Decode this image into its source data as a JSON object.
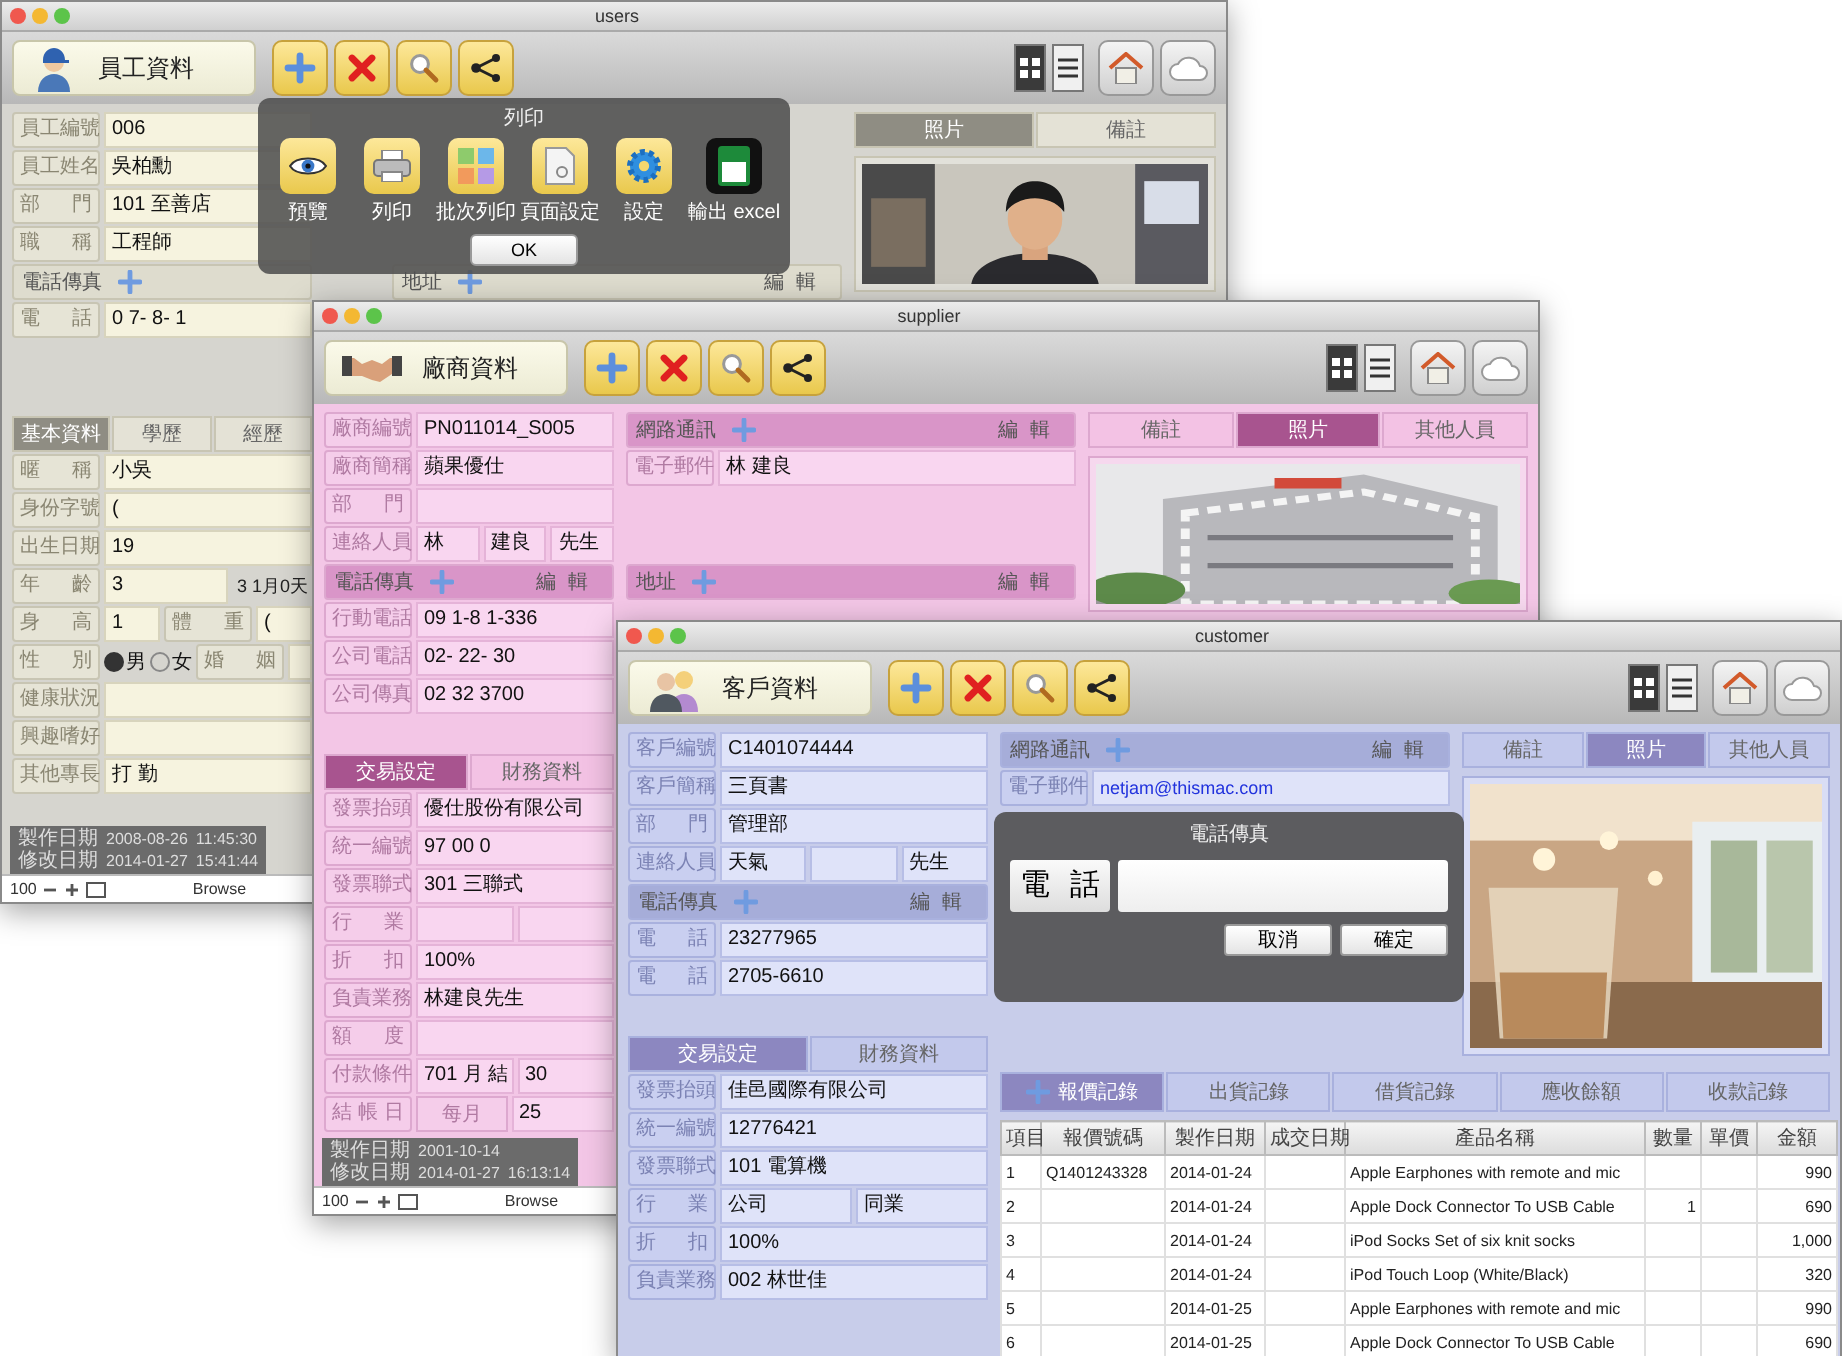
{
  "windows": [
    {
      "kind": "employee",
      "title": "users",
      "heading": "員工資料",
      "popover": {
        "title": "列印",
        "items": [
          {
            "label": "預覽"
          },
          {
            "label": "列印"
          },
          {
            "label": "批次列印"
          },
          {
            "label": "頁面設定"
          },
          {
            "label": "設定"
          },
          {
            "label": "輸出 excel"
          }
        ],
        "ok": "OK"
      },
      "left": [
        {
          "kind": "field",
          "cells": [
            {
              "kind": "label",
              "text": "員工編號"
            },
            {
              "kind": "value",
              "text": "006"
            }
          ]
        },
        {
          "kind": "field",
          "cells": [
            {
              "kind": "label",
              "text": "員工姓名"
            },
            {
              "kind": "value",
              "text": "吳柏勳"
            }
          ]
        },
        {
          "kind": "field",
          "cells": [
            {
              "kind": "label",
              "text": "部門"
            },
            {
              "kind": "value",
              "text": "101 至善店"
            }
          ]
        },
        {
          "kind": "field",
          "cells": [
            {
              "kind": "label",
              "text": "職稱"
            },
            {
              "kind": "value",
              "text": "工程師"
            }
          ]
        },
        {
          "kind": "section",
          "label": "電話傳真"
        },
        {
          "kind": "field",
          "cells": [
            {
              "kind": "label",
              "text": "電話"
            },
            {
              "kind": "value",
              "text": "0 7- 8- 1"
            }
          ]
        },
        {
          "kind": "gap"
        },
        {
          "kind": "gap"
        },
        {
          "kind": "tabs",
          "tabs": [
            {
              "label": "基本資料",
              "selected": true
            },
            {
              "label": "學歷",
              "selected": false
            },
            {
              "label": "經歷",
              "selected": false
            }
          ]
        },
        {
          "kind": "field",
          "cells": [
            {
              "kind": "label",
              "text": "暱稱"
            },
            {
              "kind": "value",
              "text": "小吳"
            }
          ]
        },
        {
          "kind": "field",
          "cells": [
            {
              "kind": "label",
              "text": "身份字號"
            },
            {
              "kind": "value",
              "text": "("
            }
          ]
        },
        {
          "kind": "field",
          "cells": [
            {
              "kind": "label",
              "text": "出生日期"
            },
            {
              "kind": "value",
              "text": "19"
            }
          ]
        },
        {
          "kind": "field",
          "cells": [
            {
              "kind": "label",
              "text": "年齡"
            },
            {
              "kind": "value",
              "text": "3"
            },
            {
              "kind": "text",
              "text": "3 1月0天"
            }
          ]
        },
        {
          "kind": "field",
          "cells": [
            {
              "kind": "label",
              "text": "身高"
            },
            {
              "kind": "value",
              "text": "1"
            },
            {
              "kind": "label",
              "text": "體重"
            },
            {
              "kind": "value",
              "text": "("
            }
          ]
        },
        {
          "kind": "field",
          "cells": [
            {
              "kind": "label",
              "text": "性別"
            },
            {
              "kind": "radio",
              "text": "男",
              "selected": true
            },
            {
              "kind": "radio",
              "text": "女",
              "selected": false
            },
            {
              "kind": "label",
              "text": "婚姻"
            },
            {
              "kind": "value"
            }
          ]
        },
        {
          "kind": "field",
          "cells": [
            {
              "kind": "label",
              "text": "健康狀況"
            },
            {
              "kind": "value"
            }
          ]
        },
        {
          "kind": "field",
          "cells": [
            {
              "kind": "label",
              "text": "興趣嗜好"
            },
            {
              "kind": "value"
            }
          ]
        },
        {
          "kind": "field",
          "cells": [
            {
              "kind": "label",
              "text": "其他專長"
            },
            {
              "kind": "value",
              "text": "打 勤"
            }
          ]
        }
      ],
      "mid": [
        {
          "kind": "gap"
        },
        {
          "kind": "gap"
        },
        {
          "kind": "gap"
        },
        {
          "kind": "gap"
        },
        {
          "kind": "section",
          "label": "地址",
          "edit": "編輯"
        }
      ],
      "panel": {
        "tabs": [
          {
            "label": "照片",
            "selected": true
          },
          {
            "label": "備註",
            "selected": false
          }
        ]
      },
      "footer": {
        "stamps": [
          {
            "label": "製作日期",
            "date": "2008-08-26",
            "time": "11:45:30"
          },
          {
            "label": "修改日期",
            "date": "2014-01-27",
            "time": "15:41:44"
          }
        ],
        "zoom": "100",
        "mode": "Browse"
      }
    },
    {
      "kind": "supplier",
      "title": "supplier",
      "heading": "廠商資料",
      "left": [
        {
          "kind": "field",
          "cells": [
            {
              "kind": "label",
              "text": "廠商編號"
            },
            {
              "kind": "value",
              "text": "PN011014_S005"
            }
          ]
        },
        {
          "kind": "field",
          "cells": [
            {
              "kind": "label",
              "text": "廠商簡稱"
            },
            {
              "kind": "value",
              "text": "蘋果優仕"
            }
          ]
        },
        {
          "kind": "field",
          "cells": [
            {
              "kind": "label",
              "text": "部門"
            },
            {
              "kind": "value"
            }
          ]
        },
        {
          "kind": "field",
          "cells": [
            {
              "kind": "label",
              "text": "連絡人員"
            },
            {
              "kind": "value",
              "text": "林"
            },
            {
              "kind": "value",
              "text": "建良"
            },
            {
              "kind": "value",
              "text": "先生"
            }
          ]
        },
        {
          "kind": "section",
          "label": "電話傳真",
          "edit": "編輯"
        },
        {
          "kind": "field",
          "cells": [
            {
              "kind": "label",
              "text": "行動電話"
            },
            {
              "kind": "value",
              "text": "09 1-8 1-336"
            }
          ]
        },
        {
          "kind": "field",
          "cells": [
            {
              "kind": "label",
              "text": "公司電話"
            },
            {
              "kind": "value",
              "text": "02- 22- 30"
            }
          ]
        },
        {
          "kind": "field",
          "cells": [
            {
              "kind": "label",
              "text": "公司傳真"
            },
            {
              "kind": "value",
              "text": "02 32 3700"
            }
          ]
        },
        {
          "kind": "gap"
        },
        {
          "kind": "tabs",
          "tabs": [
            {
              "label": "交易設定",
              "selected": true
            },
            {
              "label": "財務資料",
              "selected": false
            }
          ]
        },
        {
          "kind": "field",
          "cells": [
            {
              "kind": "label",
              "text": "發票抬頭"
            },
            {
              "kind": "value",
              "text": "優仕股份有限公司"
            }
          ]
        },
        {
          "kind": "field",
          "cells": [
            {
              "kind": "label",
              "text": "統一編號"
            },
            {
              "kind": "value",
              "text": "97 00 0"
            }
          ]
        },
        {
          "kind": "field",
          "cells": [
            {
              "kind": "label",
              "text": "發票聯式"
            },
            {
              "kind": "value",
              "text": "301 三聯式"
            }
          ]
        },
        {
          "kind": "field",
          "cells": [
            {
              "kind": "label",
              "text": "行業"
            },
            {
              "kind": "value"
            },
            {
              "kind": "value"
            }
          ]
        },
        {
          "kind": "field",
          "cells": [
            {
              "kind": "label",
              "text": "折扣"
            },
            {
              "kind": "value",
              "text": "100%"
            }
          ]
        },
        {
          "kind": "field",
          "cells": [
            {
              "kind": "label",
              "text": "負責業務"
            },
            {
              "kind": "value",
              "text": "林建良先生"
            }
          ]
        },
        {
          "kind": "field",
          "cells": [
            {
              "kind": "label",
              "text": "額度"
            },
            {
              "kind": "value"
            }
          ]
        },
        {
          "kind": "field",
          "cells": [
            {
              "kind": "label",
              "text": "付款條件"
            },
            {
              "kind": "value",
              "text": "701 月 結"
            },
            {
              "kind": "value",
              "text": "30"
            }
          ]
        },
        {
          "kind": "field",
          "cells": [
            {
              "kind": "label",
              "text": "結帳日"
            },
            {
              "kind": "button",
              "text": "每月"
            },
            {
              "kind": "value",
              "text": "25"
            }
          ]
        }
      ],
      "mid": [
        {
          "kind": "section",
          "label": "網路通訊",
          "edit": "編輯"
        },
        {
          "kind": "field",
          "cells": [
            {
              "kind": "label",
              "text": "電子郵件"
            },
            {
              "kind": "value",
              "text": "林 建良"
            }
          ]
        },
        {
          "kind": "gap"
        },
        {
          "kind": "gap"
        },
        {
          "kind": "section",
          "label": "地址",
          "edit": "編輯"
        }
      ],
      "panel": {
        "tabs": [
          {
            "label": "備註",
            "selected": false
          },
          {
            "label": "照片",
            "selected": true
          },
          {
            "label": "其他人員",
            "selected": false
          }
        ]
      },
      "footer": {
        "stamps": [
          {
            "label": "製作日期",
            "date": "2001-10-14"
          },
          {
            "label": "修改日期",
            "date": "2014-01-27",
            "time": "16:13:14"
          }
        ],
        "zoom": "100",
        "mode": "Browse"
      }
    },
    {
      "kind": "customer",
      "title": "customer",
      "heading": "客戶資料",
      "dialog": {
        "title": "電話傳真",
        "label": "電話",
        "cancel": "取消",
        "confirm": "確定"
      },
      "left": [
        {
          "kind": "field",
          "cells": [
            {
              "kind": "label",
              "text": "客戶編號"
            },
            {
              "kind": "value",
              "text": "C1401074444"
            }
          ]
        },
        {
          "kind": "field",
          "cells": [
            {
              "kind": "label",
              "text": "客戶簡稱"
            },
            {
              "kind": "value",
              "text": "三頁書"
            }
          ]
        },
        {
          "kind": "field",
          "cells": [
            {
              "kind": "label",
              "text": "部門"
            },
            {
              "kind": "value",
              "text": "管理部"
            }
          ]
        },
        {
          "kind": "field",
          "cells": [
            {
              "kind": "label",
              "text": "連絡人員"
            },
            {
              "kind": "value",
              "text": "天氣"
            },
            {
              "kind": "value"
            },
            {
              "kind": "value",
              "text": "先生"
            }
          ]
        },
        {
          "kind": "section",
          "label": "電話傳真",
          "edit": "編輯"
        },
        {
          "kind": "field",
          "cells": [
            {
              "kind": "label",
              "text": "電話"
            },
            {
              "kind": "value",
              "text": "23277965"
            }
          ]
        },
        {
          "kind": "field",
          "cells": [
            {
              "kind": "label",
              "text": "電話"
            },
            {
              "kind": "value",
              "text": "2705-6610"
            }
          ]
        },
        {
          "kind": "gap"
        },
        {
          "kind": "tabs",
          "tabs": [
            {
              "label": "交易設定",
              "selected": true
            },
            {
              "label": "財務資料",
              "selected": false
            }
          ]
        },
        {
          "kind": "field",
          "cells": [
            {
              "kind": "label",
              "text": "發票抬頭"
            },
            {
              "kind": "value",
              "text": "佳邑國際有限公司"
            }
          ]
        },
        {
          "kind": "field",
          "cells": [
            {
              "kind": "label",
              "text": "統一編號"
            },
            {
              "kind": "value",
              "text": "12776421"
            }
          ]
        },
        {
          "kind": "field",
          "cells": [
            {
              "kind": "label",
              "text": "發票聯式"
            },
            {
              "kind": "value",
              "text": "101 電算機"
            }
          ]
        },
        {
          "kind": "field",
          "cells": [
            {
              "kind": "label",
              "text": "行業"
            },
            {
              "kind": "value",
              "text": "公司"
            },
            {
              "kind": "value",
              "text": "同業"
            }
          ]
        },
        {
          "kind": "field",
          "cells": [
            {
              "kind": "label",
              "text": "折扣"
            },
            {
              "kind": "value",
              "text": "100%"
            }
          ]
        },
        {
          "kind": "field",
          "cells": [
            {
              "kind": "label",
              "text": "負責業務"
            },
            {
              "kind": "value",
              "text": "002 林世佳"
            }
          ]
        }
      ],
      "mid": [
        {
          "kind": "section",
          "label": "網路通訊",
          "edit": "編輯"
        },
        {
          "kind": "field",
          "cells": [
            {
              "kind": "label",
              "text": "電子郵件"
            },
            {
              "kind": "link",
              "text": "netjam@thismac.com"
            }
          ]
        }
      ],
      "panel": {
        "tabs": [
          {
            "label": "備註",
            "selected": false
          },
          {
            "label": "照片",
            "selected": true
          },
          {
            "label": "其他人員",
            "selected": false
          }
        ]
      },
      "records": {
        "tabs": [
          {
            "label": "報價記錄",
            "selected": true
          },
          {
            "label": "出貨記錄",
            "selected": false
          },
          {
            "label": "借貨記錄",
            "selected": false
          },
          {
            "label": "應收餘額",
            "selected": false
          },
          {
            "label": "收款記錄",
            "selected": false
          }
        ],
        "columns": [
          "項目",
          "報價號碼",
          "製作日期",
          "成交日期",
          "產品名稱",
          "數量",
          "單價",
          "金額"
        ],
        "rows": [
          [
            "1",
            "Q1401243328",
            "2014-01-24",
            "",
            "Apple Earphones with remote and mic",
            "",
            "",
            "990"
          ],
          [
            "2",
            "",
            "2014-01-24",
            "",
            "Apple Dock Connector To USB Cable",
            "1",
            "",
            "690"
          ],
          [
            "3",
            "",
            "2014-01-24",
            "",
            "iPod Socks Set of six knit socks",
            "",
            "",
            "1,000"
          ],
          [
            "4",
            "",
            "2014-01-24",
            "",
            "iPod Touch Loop (White/Black)",
            "",
            "",
            "320"
          ],
          [
            "5",
            "",
            "2014-01-25",
            "",
            "Apple Earphones with remote and mic",
            "",
            "",
            "990"
          ],
          [
            "6",
            "",
            "2014-01-25",
            "",
            "Apple Dock Connector To USB Cable",
            "",
            "",
            "690"
          ]
        ]
      }
    }
  ]
}
